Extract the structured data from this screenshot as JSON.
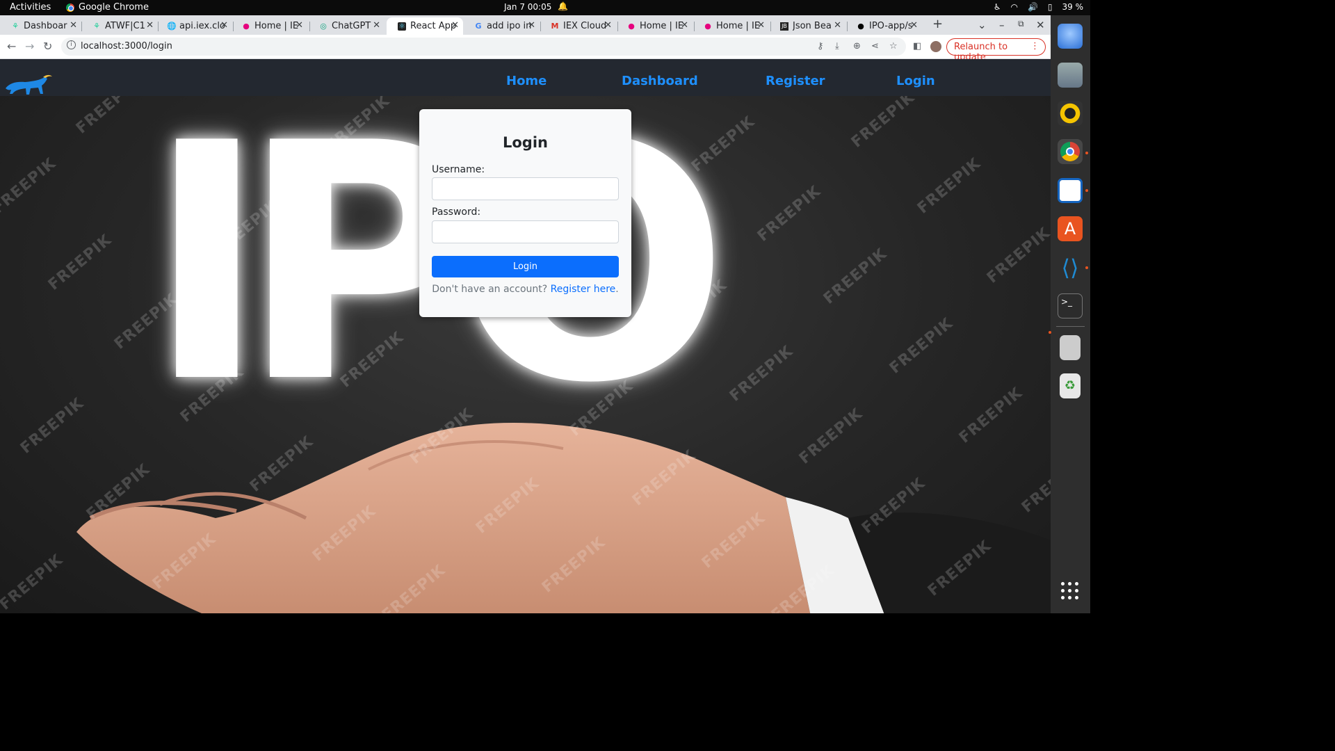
{
  "system_bar": {
    "activities": "Activities",
    "app_name": "Google Chrome",
    "clock": "Jan 7  00:05",
    "battery": "39 %"
  },
  "tabs": [
    {
      "title": "Dashboar",
      "icon": "robinhood-feather-icon"
    },
    {
      "title": "ATWF|C1",
      "icon": "robinhood-feather-icon"
    },
    {
      "title": "api.iex.clo",
      "icon": "globe-icon"
    },
    {
      "title": "Home | IE",
      "icon": "iex-cloud-icon"
    },
    {
      "title": "ChatGPT",
      "icon": "chatgpt-icon"
    },
    {
      "title": "React App",
      "icon": "react-icon",
      "active": true
    },
    {
      "title": "add ipo in",
      "icon": "google-icon"
    },
    {
      "title": "IEX Cloud",
      "icon": "gmail-icon"
    },
    {
      "title": "Home | IE",
      "icon": "iex-cloud-icon"
    },
    {
      "title": "Home | IE",
      "icon": "iex-cloud-icon"
    },
    {
      "title": "Json Bea",
      "icon": "json-beautifier-icon"
    },
    {
      "title": "IPO-app/s",
      "icon": "github-icon"
    }
  ],
  "browser": {
    "url": "localhost:3000/login",
    "relaunch_label": "Relaunch to update"
  },
  "navbar": {
    "links": [
      "Home",
      "Dashboard",
      "Register",
      "Login"
    ],
    "link_color": "#1e90ff"
  },
  "hero": {
    "text": "IPO",
    "watermark": "FREEPIK"
  },
  "login": {
    "title": "Login",
    "username_label": "Username:",
    "username_value": "",
    "password_label": "Password:",
    "password_value": "",
    "submit_label": "Login",
    "footer_text": "Don't have an account? ",
    "register_link": "Register here",
    "footer_end": ".",
    "button_color": "#0b6efd"
  }
}
